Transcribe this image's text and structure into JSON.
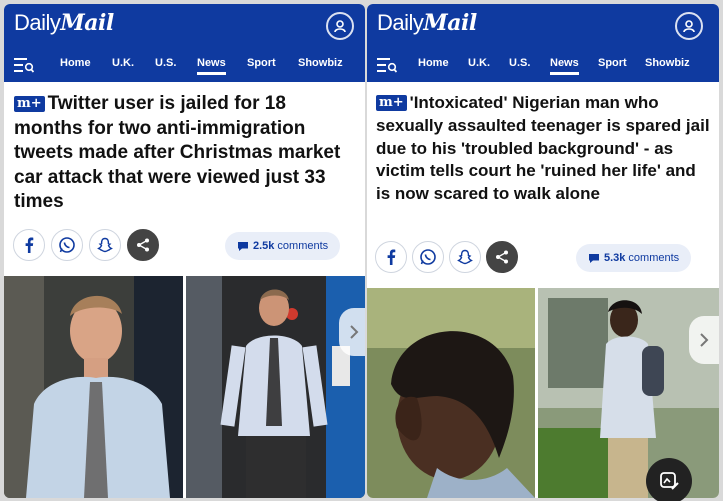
{
  "left": {
    "logo": {
      "daily": "Daily",
      "mail": "Mail"
    },
    "nav": [
      "Home",
      "U.K.",
      "U.S.",
      "News",
      "Sport",
      "Showbiz"
    ],
    "active_nav": "News",
    "badge": "m+",
    "headline": "Twitter user is jailed for 18 months for two anti-immigration tweets made after Christmas market car attack that were viewed just 33 times",
    "comments": {
      "count": "2.5k",
      "label": "comments"
    },
    "icons": [
      "facebook-icon",
      "whatsapp-icon",
      "snapchat-icon",
      "share-icon"
    ]
  },
  "right": {
    "logo": {
      "daily": "Daily",
      "mail": "Mail"
    },
    "nav": [
      "Home",
      "U.K.",
      "U.S.",
      "News",
      "Sport",
      "Showbiz"
    ],
    "active_nav": "News",
    "badge": "m+",
    "headline": "'Intoxicated' Nigerian man who sexually assaulted teenager is spared jail due to his 'troubled background' - as victim tells court he 'ruined her life' and is now scared to walk alone",
    "comments": {
      "count": "5.3k",
      "label": "comments"
    },
    "icons": [
      "facebook-icon",
      "whatsapp-icon",
      "snapchat-icon",
      "share-icon"
    ]
  },
  "colors": {
    "brand_blue": "#0f3aa0",
    "comment_bg": "#e9eef8"
  }
}
